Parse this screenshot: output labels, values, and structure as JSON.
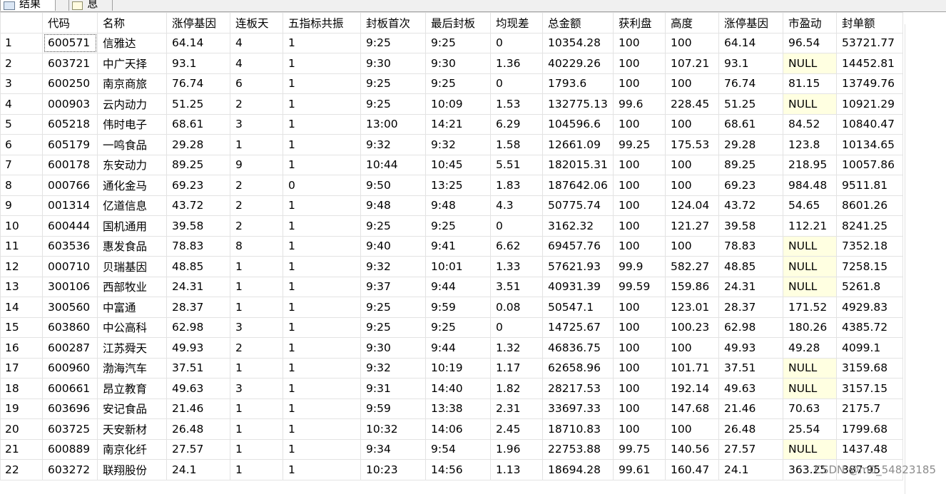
{
  "tabs": [
    {
      "label": "结果",
      "icon": "results-grid-icon"
    },
    {
      "label": "消息",
      "icon": "messages-icon"
    }
  ],
  "columns": [
    "",
    "代码",
    "名称",
    "涨停基因",
    "连板天",
    "五指标共振",
    "封板首次",
    "最后封板",
    "均现差",
    "总金额",
    "获利盘",
    "高度",
    "涨停基因",
    "市盈动",
    "封单额"
  ],
  "rows": [
    [
      "1",
      "600571",
      "信雅达",
      "64.14",
      "4",
      "1",
      "9:25",
      "9:25",
      "0",
      "10354.28",
      "100",
      "100",
      "64.14",
      "96.54",
      "53721.77"
    ],
    [
      "2",
      "603721",
      "中广天择",
      "93.1",
      "4",
      "1",
      "9:30",
      "9:30",
      "1.36",
      "40229.26",
      "100",
      "107.21",
      "93.1",
      "NULL",
      "14452.81"
    ],
    [
      "3",
      "600250",
      "南京商旅",
      "76.74",
      "6",
      "1",
      "9:25",
      "9:25",
      "0",
      "1793.6",
      "100",
      "100",
      "76.74",
      "81.15",
      "13749.76"
    ],
    [
      "4",
      "000903",
      "云内动力",
      "51.25",
      "2",
      "1",
      "9:25",
      "10:09",
      "1.53",
      "132775.13",
      "99.6",
      "228.45",
      "51.25",
      "NULL",
      "10921.29"
    ],
    [
      "5",
      "605218",
      "伟时电子",
      "68.61",
      "3",
      "1",
      "13:00",
      "14:21",
      "6.29",
      "104596.6",
      "100",
      "100",
      "68.61",
      "84.52",
      "10840.47"
    ],
    [
      "6",
      "605179",
      "一鸣食品",
      "29.28",
      "1",
      "1",
      "9:32",
      "9:32",
      "1.58",
      "12661.09",
      "99.25",
      "175.53",
      "29.28",
      "123.8",
      "10134.65"
    ],
    [
      "7",
      "600178",
      "东安动力",
      "89.25",
      "9",
      "1",
      "10:44",
      "10:45",
      "5.51",
      "182015.31",
      "100",
      "100",
      "89.25",
      "218.95",
      "10057.86"
    ],
    [
      "8",
      "000766",
      "通化金马",
      "69.23",
      "2",
      "0",
      "9:50",
      "13:25",
      "1.83",
      "187642.06",
      "100",
      "100",
      "69.23",
      "984.48",
      "9511.81"
    ],
    [
      "9",
      "001314",
      "亿道信息",
      "43.72",
      "2",
      "1",
      "9:48",
      "9:48",
      "4.3",
      "50775.74",
      "100",
      "124.04",
      "43.72",
      "54.65",
      "8601.26"
    ],
    [
      "10",
      "600444",
      "国机通用",
      "39.58",
      "2",
      "1",
      "9:25",
      "9:25",
      "0",
      "3162.32",
      "100",
      "121.27",
      "39.58",
      "112.21",
      "8241.25"
    ],
    [
      "11",
      "603536",
      "惠发食品",
      "78.83",
      "8",
      "1",
      "9:40",
      "9:41",
      "6.62",
      "69457.76",
      "100",
      "100",
      "78.83",
      "NULL",
      "7352.18"
    ],
    [
      "12",
      "000710",
      "贝瑞基因",
      "48.85",
      "1",
      "1",
      "9:32",
      "10:01",
      "1.33",
      "57621.93",
      "99.9",
      "582.27",
      "48.85",
      "NULL",
      "7258.15"
    ],
    [
      "13",
      "300106",
      "西部牧业",
      "24.31",
      "1",
      "1",
      "9:37",
      "9:44",
      "3.51",
      "40931.39",
      "99.59",
      "159.86",
      "24.31",
      "NULL",
      "5261.8"
    ],
    [
      "14",
      "300560",
      "中富通",
      "28.37",
      "1",
      "1",
      "9:25",
      "9:59",
      "0.08",
      "50547.1",
      "100",
      "123.01",
      "28.37",
      "171.52",
      "4929.83"
    ],
    [
      "15",
      "603860",
      "中公高科",
      "62.98",
      "3",
      "1",
      "9:25",
      "9:25",
      "0",
      "14725.67",
      "100",
      "100.23",
      "62.98",
      "180.26",
      "4385.72"
    ],
    [
      "16",
      "600287",
      "江苏舜天",
      "49.93",
      "2",
      "1",
      "9:30",
      "9:44",
      "1.32",
      "46836.75",
      "100",
      "100",
      "49.93",
      "49.28",
      "4099.1"
    ],
    [
      "17",
      "600960",
      "渤海汽车",
      "37.51",
      "1",
      "1",
      "9:32",
      "10:19",
      "1.17",
      "62658.96",
      "100",
      "101.71",
      "37.51",
      "NULL",
      "3159.68"
    ],
    [
      "18",
      "600661",
      "昂立教育",
      "49.63",
      "3",
      "1",
      "9:31",
      "14:40",
      "1.82",
      "28217.53",
      "100",
      "192.14",
      "49.63",
      "NULL",
      "3157.15"
    ],
    [
      "19",
      "603696",
      "安记食品",
      "21.46",
      "1",
      "1",
      "9:59",
      "13:38",
      "2.31",
      "33697.33",
      "100",
      "147.68",
      "21.46",
      "70.63",
      "2175.7"
    ],
    [
      "20",
      "603725",
      "天安新材",
      "26.48",
      "1",
      "1",
      "10:32",
      "14:06",
      "2.45",
      "18710.83",
      "100",
      "100",
      "26.48",
      "25.54",
      "1799.68"
    ],
    [
      "21",
      "600889",
      "南京化纤",
      "27.57",
      "1",
      "1",
      "9:34",
      "9:54",
      "1.96",
      "22753.88",
      "99.75",
      "140.56",
      "27.57",
      "NULL",
      "1437.48"
    ],
    [
      "22",
      "603272",
      "联翔股份",
      "24.1",
      "1",
      "1",
      "10:23",
      "14:56",
      "1.13",
      "18694.28",
      "99.61",
      "160.47",
      "24.1",
      "363.25",
      "387.95"
    ]
  ],
  "watermark": "CSDN @m0_54823185",
  "colors": {
    "null_cell_bg": "#ffffe1",
    "grid_line": "#e3e3e3",
    "tab_bg": "#f0f0f0"
  }
}
